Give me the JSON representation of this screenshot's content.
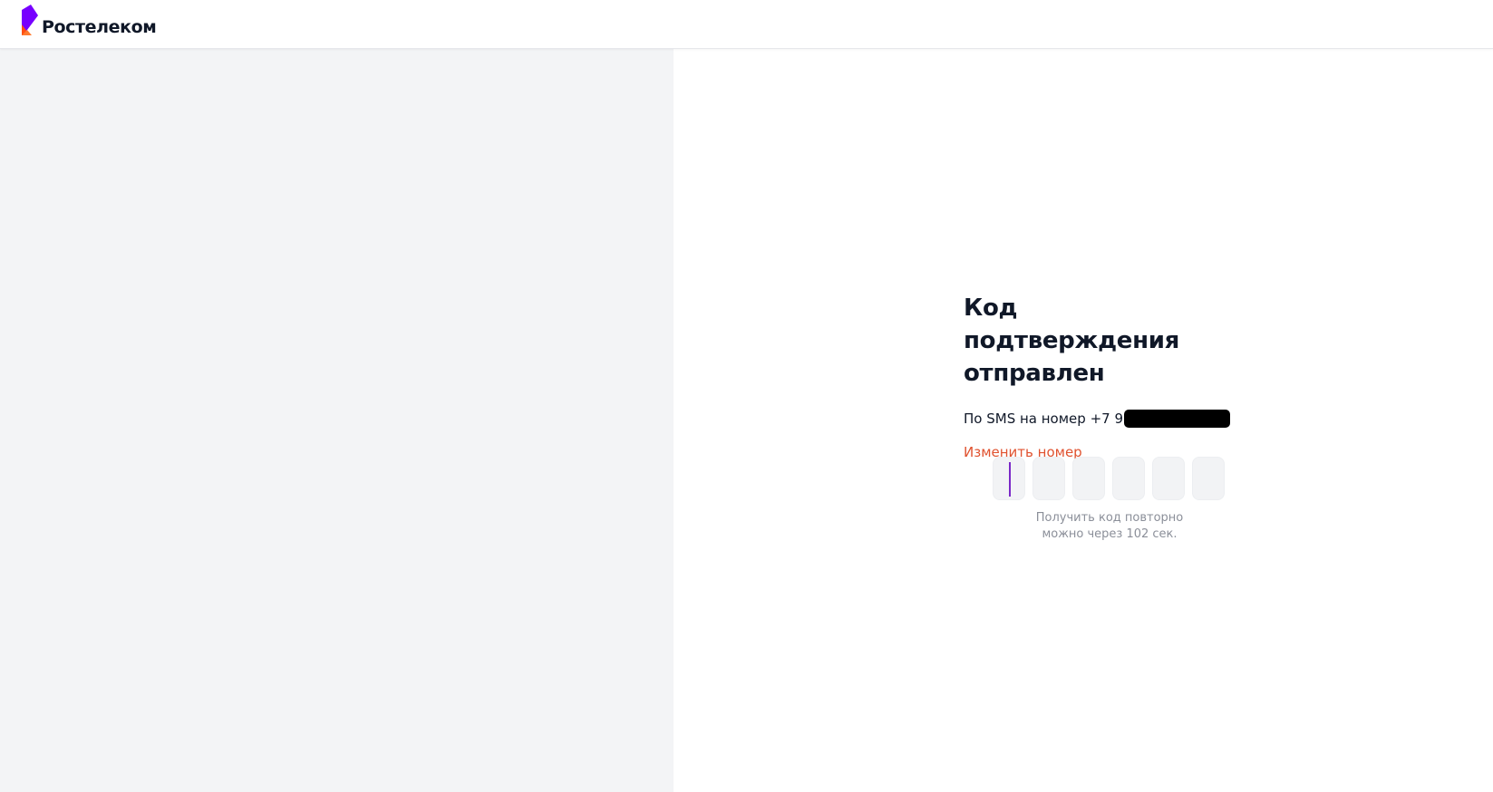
{
  "header": {
    "logo_text": "Ростелеком",
    "logo_icon": "rostelecom-logo-icon"
  },
  "colors": {
    "brand_purple": "#7700ff",
    "brand_orange": "#ff4f12",
    "link_orange": "#e0522f",
    "left_panel_bg": "#f3f4f6",
    "caret": "#7a28c8"
  },
  "form": {
    "title_line1": "Код подтверждения",
    "title_line2": "отправлен",
    "sms_prefix": "По SMS на номер +7 9",
    "change_number_link": "Изменить номер",
    "code_cells": [
      "",
      "",
      "",
      "",
      "",
      ""
    ],
    "resend_line1": "Получить код повторно",
    "resend_line2": "можно через 102 сек."
  }
}
